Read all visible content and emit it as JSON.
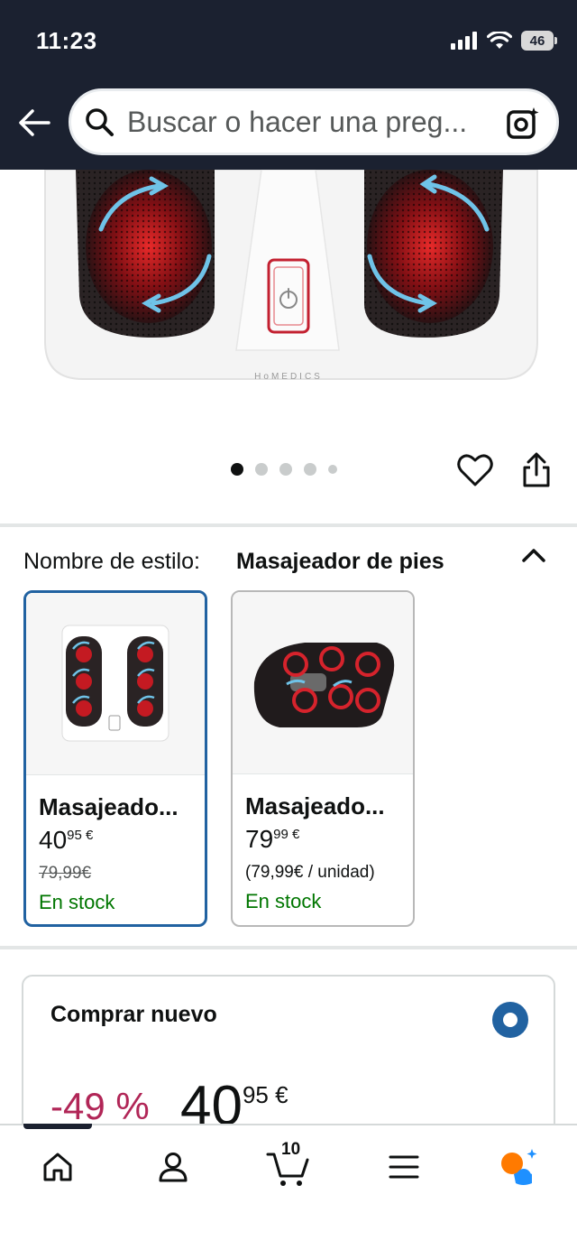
{
  "status_bar": {
    "time": "11:23",
    "battery": "46"
  },
  "search": {
    "placeholder": "Buscar o hacer una preg..."
  },
  "product_image": {
    "brand_mark": "HoMEDICS"
  },
  "carousel": {
    "dots": 5,
    "active_index": 0
  },
  "style": {
    "label": "Nombre de estilo:",
    "value": "Masajeador de pies",
    "options": [
      {
        "title": "Masajeado...",
        "price_whole": "40",
        "price_fraction": "95 €",
        "old_price": "79,99€",
        "stock": "En stock"
      },
      {
        "title": "Masajeado...",
        "price_whole": "79",
        "price_fraction": "99 €",
        "unit_price": "(79,99€ / unidad)",
        "stock": "En stock"
      }
    ]
  },
  "buy_new": {
    "title": "Comprar nuevo",
    "discount": "-49 %",
    "price_whole": "40",
    "price_fraction": "95 €"
  },
  "nav": {
    "cart_count": "10"
  },
  "colors": {
    "header_bg": "#1b2130",
    "selected_border": "#2162a1",
    "stock_green": "#007600",
    "discount_red": "#b12657",
    "alexa_orange": "#ff7a00",
    "alexa_blue": "#1e90ff"
  }
}
